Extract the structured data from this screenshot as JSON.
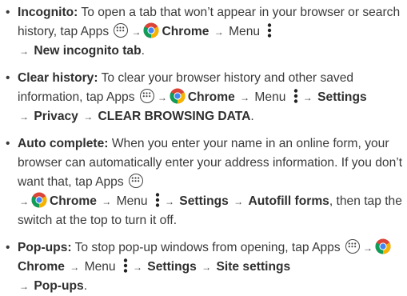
{
  "items": [
    {
      "term": "Incognito:",
      "t1": " To open a tab that won’t appear in your browser or search history, tap Apps ",
      "chrome": "Chrome",
      "menu": " Menu ",
      "s1": "New incognito tab",
      "end": "."
    },
    {
      "term": "Clear history:",
      "t1": " To clear your browser history and other saved information, tap Apps ",
      "chrome": "Chrome",
      "menu": " Menu ",
      "s1": "Settings",
      "s2": "Privacy",
      "s3": "CLEAR BROWSING DATA",
      "end": "."
    },
    {
      "term": "Auto complete:",
      "t1": " When you enter your name in an online form, your browser can automatically enter your address information. If you don’t want that, tap Apps ",
      "chrome": "Chrome",
      "menu": " Menu ",
      "s1": "Settings",
      "s2": "Autofill forms",
      "end": ", then tap the switch at the top to turn it off."
    },
    {
      "term": "Pop-ups:",
      "t1": " To stop pop-up windows from opening, tap Apps ",
      "chrome": "Chrome",
      "menu": " Menu ",
      "s1": "Settings",
      "s2": "Site settings",
      "s3": "Pop-ups",
      "end": "."
    }
  ],
  "symbols": {
    "bullet": "•",
    "arrow": "→"
  },
  "icons": {
    "apps": "apps-icon",
    "chrome": "chrome-icon",
    "menu": "menu-icon"
  },
  "colors": {
    "text": "#3a3a3a",
    "chrome_red": "#db4437",
    "chrome_yellow": "#f4b400",
    "chrome_green": "#0f9d58",
    "chrome_blue": "#4285f4"
  }
}
